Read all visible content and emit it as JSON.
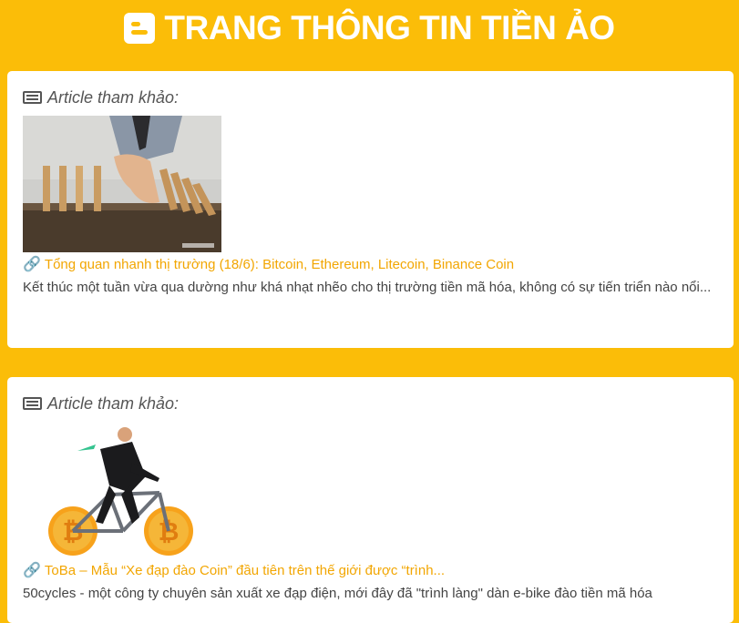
{
  "header": {
    "logo_icon": "blogger-icon",
    "title": "TRANG THÔNG TIN TIỀN ẢO"
  },
  "colors": {
    "background": "#fbbd08",
    "link": "#f2a602",
    "card": "#ffffff"
  },
  "articles": [
    {
      "heading": "Article tham khảo:",
      "heading_icon": "list-alt-icon",
      "image_desc": "dominoes-hand",
      "link_icon": "link-icon",
      "link_text": "Tổng quan nhanh thị trường (18/6): Bitcoin, Ethereum, Litecoin, Binance Coin",
      "excerpt": "Kết thúc một tuần vừa qua dường như khá nhạt nhẽo cho thị trường tiền mã hóa, không có sự tiến triển nào nổi..."
    },
    {
      "heading": "Article tham khảo:",
      "heading_icon": "list-alt-icon",
      "image_desc": "bitcoin-bicycle",
      "link_icon": "link-icon",
      "link_text": "ToBa – Mẫu “Xe đạp đào Coin” đầu tiên trên thế giới được “trình...",
      "excerpt": "50cycles - một công ty chuyên sản xuất xe đạp điện, mới đây đã \"trình làng\" dàn e-bike đào tiền mã hóa"
    }
  ]
}
